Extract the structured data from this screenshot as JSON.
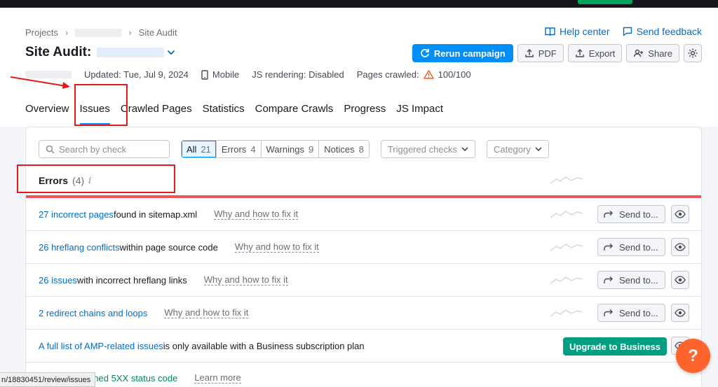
{
  "breadcrumb": {
    "projects": "Projects",
    "current": "Site Audit"
  },
  "help": {
    "help_center": "Help center",
    "send_feedback": "Send feedback"
  },
  "title": {
    "label": "Site Audit:"
  },
  "actions": {
    "rerun": "Rerun campaign",
    "pdf": "PDF",
    "export": "Export",
    "share": "Share"
  },
  "meta": {
    "updated": "Updated: Tue, Jul 9, 2024",
    "device": "Mobile",
    "js_rendering": "JS rendering: Disabled",
    "pages_crawled_label": "Pages crawled:",
    "pages_crawled_value": "100/100"
  },
  "tabs": [
    "Overview",
    "Issues",
    "Crawled Pages",
    "Statistics",
    "Compare Crawls",
    "Progress",
    "JS Impact"
  ],
  "filters": {
    "search_placeholder": "Search by check",
    "segments": [
      {
        "label": "All",
        "count": "21"
      },
      {
        "label": "Errors",
        "count": "4"
      },
      {
        "label": "Warnings",
        "count": "9"
      },
      {
        "label": "Notices",
        "count": "8"
      }
    ],
    "triggered_checks": "Triggered checks",
    "category": "Category"
  },
  "errors_section": {
    "title": "Errors",
    "count": "(4)",
    "info": "i"
  },
  "issues": [
    {
      "link": "27 incorrect pages",
      "rest": " found in sitemap.xml",
      "fix": "Why and how to fix it",
      "send": "Send to..."
    },
    {
      "link": "26 hreflang conflicts",
      "rest": " within page source code",
      "fix": "Why and how to fix it",
      "send": "Send to..."
    },
    {
      "link": "26 issues",
      "rest": " with incorrect hreflang links",
      "fix": "Why and how to fix it",
      "send": "Send to..."
    },
    {
      "link": "2 redirect chains and loops",
      "rest": "",
      "fix": "Why and how to fix it",
      "send": "Send to..."
    }
  ],
  "amp_row": {
    "link": "A full list of AMP-related issues",
    "rest": " is only available with a Business subscription plan",
    "upgrade": "Upgrade to Business"
  },
  "last_row": {
    "text": "rned 5XX status code",
    "learn": "Learn more"
  },
  "fab": {
    "label": "?"
  },
  "status_bar": {
    "url": "n/18830451/review/issues"
  },
  "colors": {
    "primary": "#008ff8",
    "link": "#006dca",
    "error_line": "#f0505a",
    "upgrade": "#009f81",
    "fab": "#ff642d",
    "annotation": "#e11a1a"
  }
}
